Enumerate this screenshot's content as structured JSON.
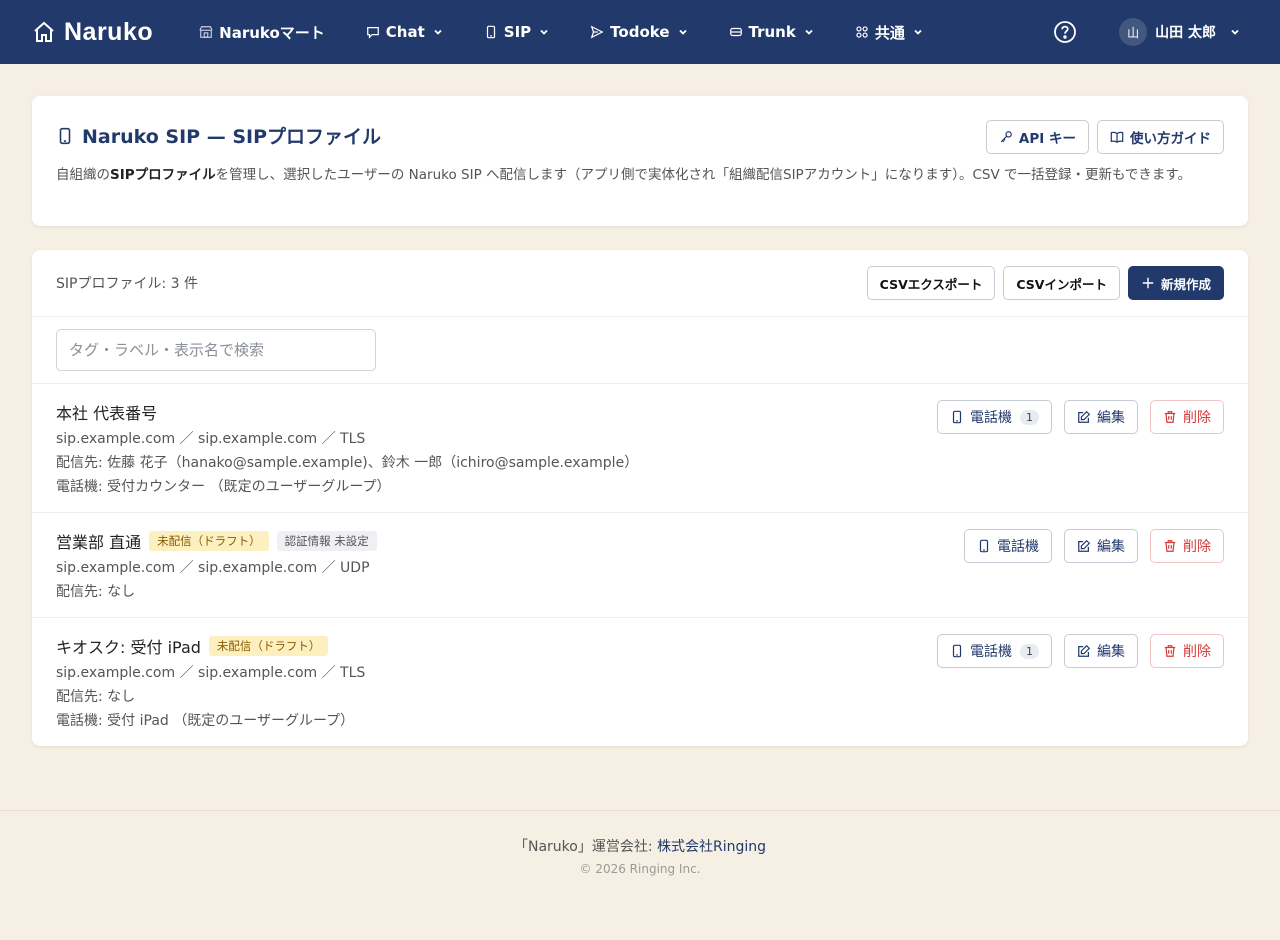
{
  "nav": {
    "brand": "Naruko",
    "items": [
      {
        "label": "Narukoマート",
        "icon": "store-icon",
        "dropdown": false
      },
      {
        "label": "Chat",
        "icon": "chat-icon",
        "dropdown": true
      },
      {
        "label": "SIP",
        "icon": "phone-icon",
        "dropdown": true
      },
      {
        "label": "Todoke",
        "icon": "send-icon",
        "dropdown": true
      },
      {
        "label": "Trunk",
        "icon": "trunk-icon",
        "dropdown": true
      },
      {
        "label": "共通",
        "icon": "grid-icon",
        "dropdown": true
      }
    ],
    "user": {
      "initial": "山",
      "name": "山田 太郎"
    }
  },
  "header": {
    "title": "Naruko SIP — SIPプロファイル",
    "api_key_label": "API キー",
    "guide_label": "使い方ガイド",
    "desc_prefix": "自組織の",
    "desc_bold": "SIPプロファイル",
    "desc_suffix": "を管理し、選択したユーザーの Naruko SIP へ配信します（アプリ側で実体化され「組織配信SIPアカウント」になります）。CSV で一括登録・更新もできます。"
  },
  "list": {
    "count_text": "SIPプロファイル: 3 件",
    "export_label": "CSVエクスポート",
    "import_label": "CSVインポート",
    "new_label": "新規作成",
    "search_placeholder": "タグ・ラベル・表示名で検索",
    "btn_phone": "電話機",
    "btn_edit": "編集",
    "btn_delete": "削除",
    "rows": [
      {
        "title": "本社 代表番号",
        "badges": [],
        "server": "sip.example.com ／ sip.example.com ／ TLS",
        "delivery": "配信先: 佐藤 花子（hanako@sample.example)、鈴木 一郎（ichiro@sample.example）",
        "device": "電話機: 受付カウンター （既定のユーザーグループ）",
        "phone_count": "1"
      },
      {
        "title": "営業部 直通",
        "badges": [
          {
            "text": "未配信（ドラフト）",
            "kind": "draft"
          },
          {
            "text": "認証情報 未設定",
            "kind": "gray"
          }
        ],
        "server": "sip.example.com ／ sip.example.com ／ UDP",
        "delivery": "配信先: なし",
        "device": "",
        "phone_count": ""
      },
      {
        "title": "キオスク: 受付 iPad",
        "badges": [
          {
            "text": "未配信（ドラフト）",
            "kind": "draft"
          }
        ],
        "server": "sip.example.com ／ sip.example.com ／ TLS",
        "delivery": "配信先: なし",
        "device": "電話機: 受付 iPad （既定のユーザーグループ）",
        "phone_count": "1"
      }
    ]
  },
  "footer": {
    "prefix": "「Naruko」運営会社: ",
    "company": "株式会社Ringing",
    "copyright": "© 2026 Ringing Inc."
  }
}
